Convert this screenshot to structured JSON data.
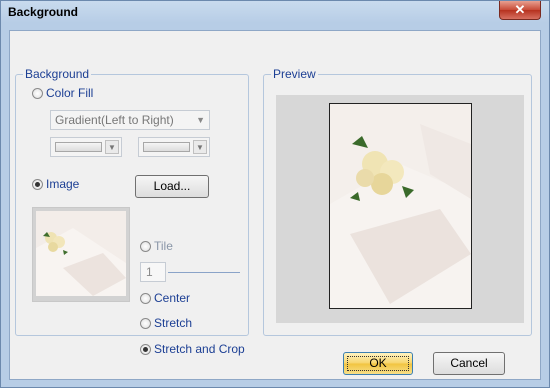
{
  "window": {
    "title": "Background",
    "close_glyph": "✕"
  },
  "background_group": {
    "legend": "Background",
    "color_fill": {
      "label": "Color Fill",
      "selected": false
    },
    "gradient_select": {
      "value": "Gradient(Left to Right)"
    },
    "image": {
      "label": "Image",
      "selected": true
    },
    "load_button": "Load...",
    "tile": {
      "label": "Tile",
      "selected": false
    },
    "tile_count": "1",
    "center": {
      "label": "Center",
      "selected": false
    },
    "stretch": {
      "label": "Stretch",
      "selected": false
    },
    "stretch_and_crop": {
      "label": "Stretch and Crop",
      "selected": true
    }
  },
  "preview_group": {
    "legend": "Preview"
  },
  "footer": {
    "ok_label": "OK",
    "cancel_label": "Cancel"
  },
  "icons": [
    "close-icon",
    "chevron-down-icon"
  ],
  "colors": {
    "accent_blue": "#1c3f94",
    "title_gradient": "#b7cde6",
    "close_red": "#c74a36",
    "ok_yellow": "#f1c43f"
  }
}
